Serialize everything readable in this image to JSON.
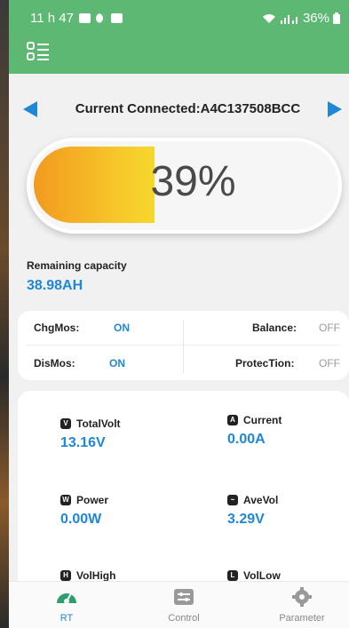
{
  "status_bar": {
    "time": "11 h 47",
    "battery": "36%"
  },
  "connection": {
    "label": "Current Connected:A4C137508BCC"
  },
  "battery": {
    "percent_text": "39%",
    "level": 0.39
  },
  "remaining": {
    "label": "Remaining capacity",
    "value": "38.98AH"
  },
  "mos": {
    "chg_label": "ChgMos:",
    "chg_value": "ON",
    "dis_label": "DisMos:",
    "dis_value": "ON",
    "balance_label": "Balance:",
    "balance_value": "OFF",
    "protection_label": "ProtecTion:",
    "protection_value": "OFF"
  },
  "metrics": {
    "total_volt": {
      "label": "TotalVolt",
      "value": "13.16V",
      "icon": "voltage-icon"
    },
    "current": {
      "label": "Current",
      "value": "0.00A",
      "icon": "current-icon"
    },
    "power": {
      "label": "Power",
      "value": "0.00W",
      "icon": "power-icon"
    },
    "ave_vol": {
      "label": "AveVol",
      "value": "3.29V",
      "icon": "average-voltage-icon"
    },
    "vol_high": {
      "label": "VolHigh",
      "icon": "voltage-high-icon"
    },
    "vol_low": {
      "label": "VolLow",
      "icon": "voltage-low-icon"
    }
  },
  "tabs": [
    {
      "label": "RT",
      "icon": "dashboard-icon",
      "active": true
    },
    {
      "label": "Control",
      "icon": "sliders-icon",
      "active": false
    },
    {
      "label": "Parameter",
      "icon": "gear-icon",
      "active": false
    }
  ],
  "colors": {
    "appbar": "#5cb873",
    "accent": "#1e88d6",
    "battery_fill_start": "#f29a1f",
    "battery_fill_end": "#f5d82c"
  }
}
